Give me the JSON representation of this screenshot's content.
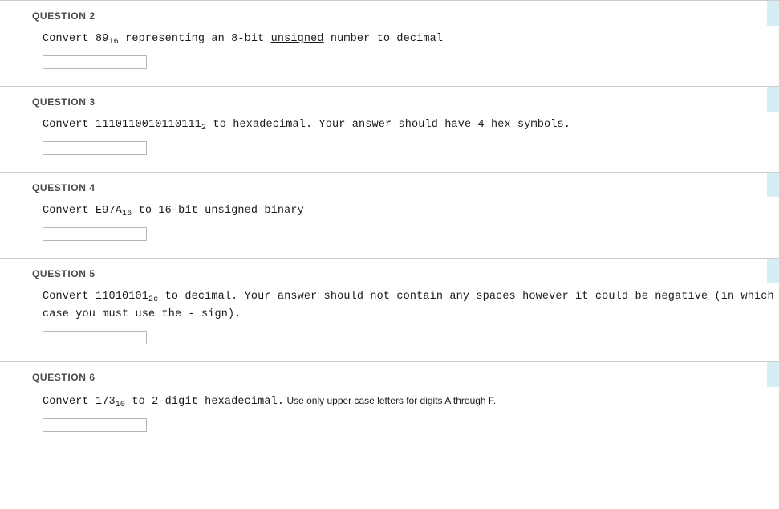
{
  "page": {
    "background_color": "#ffffff",
    "divider_color": "#cccccc",
    "heading_color": "#4a4a4a",
    "tab_color": "#d7edf4",
    "input_border_color": "#b5b5b5"
  },
  "questions": [
    {
      "heading": "QUESTION 2",
      "prompt_parts": [
        {
          "type": "mono",
          "text": "Convert 89"
        },
        {
          "type": "sub",
          "text": "16"
        },
        {
          "type": "mono",
          "text": " representing an 8-bit "
        },
        {
          "type": "underline",
          "text": "unsigned"
        },
        {
          "type": "mono",
          "text": " number to decimal"
        }
      ],
      "plain_text": "Convert 89₁₆ representing an 8-bit unsigned number to decimal",
      "answer_value": "",
      "answer_placeholder": "",
      "status_tab": true
    },
    {
      "heading": "QUESTION 3",
      "prompt_parts": [
        {
          "type": "mono",
          "text": "Convert 1110110010110111"
        },
        {
          "type": "sub",
          "text": "2"
        },
        {
          "type": "mono",
          "text": " to hexadecimal. Your answer should have 4 hex symbols."
        }
      ],
      "plain_text": "Convert 1110110010110111₂ to hexadecimal. Your answer should have 4 hex symbols.",
      "answer_value": "",
      "answer_placeholder": "",
      "status_tab": true
    },
    {
      "heading": "QUESTION 4",
      "prompt_parts": [
        {
          "type": "mono",
          "text": "Convert E97A"
        },
        {
          "type": "sub",
          "text": "16"
        },
        {
          "type": "mono",
          "text": " to 16-bit unsigned binary"
        }
      ],
      "plain_text": "Convert E97A₁₆ to 16-bit unsigned binary",
      "answer_value": "",
      "answer_placeholder": "",
      "status_tab": true
    },
    {
      "heading": "QUESTION 5",
      "prompt_parts": [
        {
          "type": "mono",
          "text": "Convert 11010101"
        },
        {
          "type": "sub",
          "text": "2c"
        },
        {
          "type": "mono",
          "text": " to decimal. Your answer should not contain any spaces however it could be negative (in which case you must use the - sign)."
        }
      ],
      "plain_text": "Convert 11010101₂c to decimal. Your answer should not contain any spaces however it could be negative (in which case you must use the - sign).",
      "answer_value": "",
      "answer_placeholder": "",
      "status_tab": true
    },
    {
      "heading": "QUESTION 6",
      "prompt_parts": [
        {
          "type": "mono",
          "text": "Convert 173"
        },
        {
          "type": "sub",
          "text": "10"
        },
        {
          "type": "mono",
          "text": " to 2-digit hexadecimal."
        },
        {
          "type": "sans",
          "text": " Use only upper case letters for digits A through F."
        }
      ],
      "plain_text": "Convert 173₁₀ to 2-digit hexadecimal. Use only upper case letters for digits A through F.",
      "answer_value": "",
      "answer_placeholder": "",
      "status_tab": true
    }
  ]
}
